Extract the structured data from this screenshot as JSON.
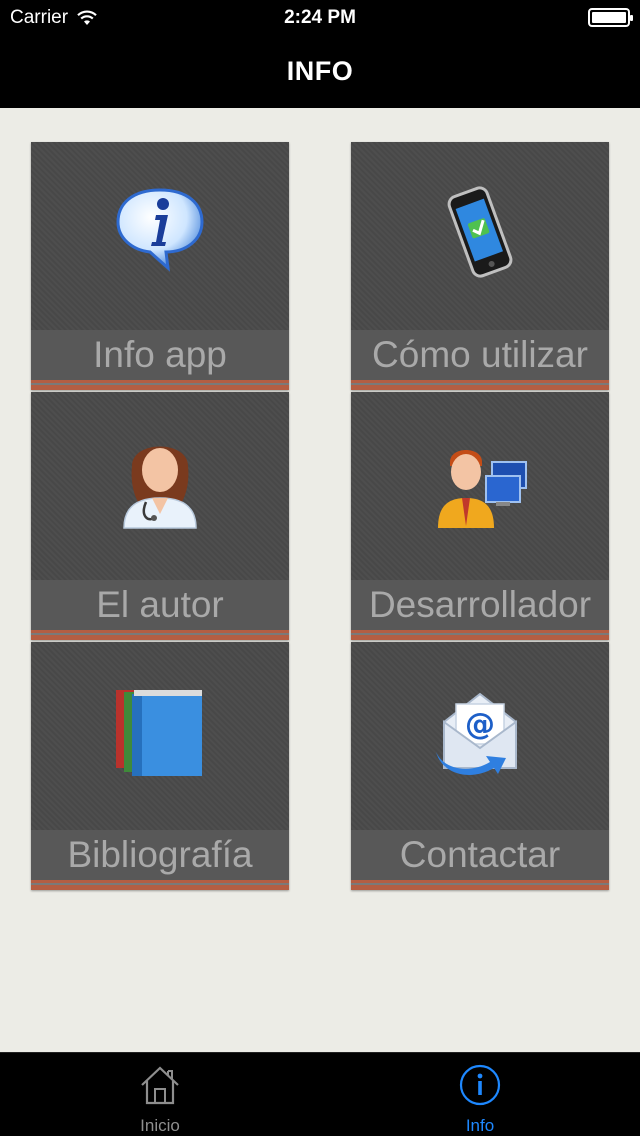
{
  "status_bar": {
    "carrier": "Carrier",
    "time": "2:24 PM"
  },
  "nav": {
    "title": "INFO"
  },
  "tiles": [
    {
      "label": "Info app",
      "icon": "info-bubble-icon"
    },
    {
      "label": "Cómo utilizar",
      "icon": "smartphone-icon"
    },
    {
      "label": "El autor",
      "icon": "doctor-icon"
    },
    {
      "label": "Desarrollador",
      "icon": "developer-icon"
    },
    {
      "label": "Bibliografía",
      "icon": "books-icon"
    },
    {
      "label": "Contactar",
      "icon": "email-envelope-icon"
    }
  ],
  "tabbar": {
    "items": [
      {
        "label": "Inicio",
        "icon": "home-icon",
        "selected": false
      },
      {
        "label": "Info",
        "icon": "info-circle-icon",
        "selected": true
      }
    ],
    "selected_color": "#1e88ff",
    "unselected_color": "#8e8e8e"
  },
  "colors": {
    "background": "#ecece6",
    "tile": "#4a4a4a",
    "accent_stripe": "#b45e43"
  }
}
